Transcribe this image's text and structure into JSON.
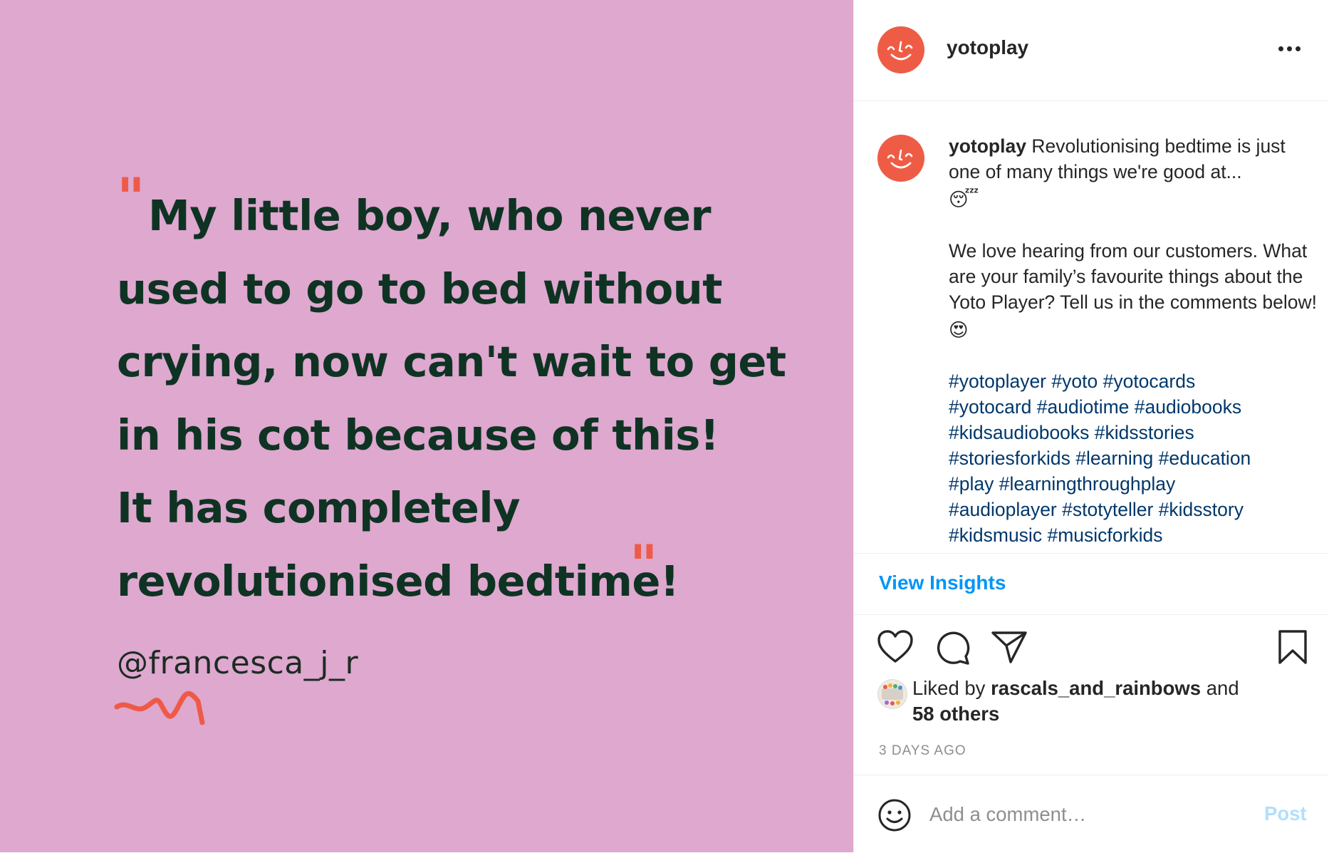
{
  "image": {
    "quote_lines": [
      "My little boy, who never",
      "used to go to bed without",
      "crying, now can't wait to get",
      "in his cot because of this!",
      "It has completely",
      "revolutionised bedtime!"
    ],
    "open_mark": "\"",
    "close_mark": "\"",
    "handle": "@francesca_j_r",
    "colors": {
      "background": "#dea8cf",
      "text": "#0f3323",
      "accent": "#ee5a47"
    }
  },
  "header": {
    "username": "yotoplay",
    "avatar_icon": "smiley-face-icon",
    "more_icon": "more-horizontal-icon"
  },
  "caption": {
    "username": "yotoplay",
    "intro": "Revolutionising bedtime is just one of many things we're good at...",
    "intro_emoji": "😴",
    "body": "We love hearing from our customers. What are your family’s favourite things about the Yoto Player? Tell us in the comments below!",
    "body_emoji": "😍",
    "hashtags": [
      [
        "#yotoplayer",
        "#yoto",
        "#yotocards"
      ],
      [
        "#yotocard",
        "#audiotime",
        "#audiobooks"
      ],
      [
        "#kidsaudiobooks",
        "#kidsstories"
      ],
      [
        "#storiesforkids",
        "#learning",
        "#education"
      ],
      [
        "#play",
        "#learningthroughplay"
      ],
      [
        "#audioplayer",
        "#stotyteller",
        "#kidsstory"
      ],
      [
        "#kidsmusic",
        "#musicforkids"
      ]
    ]
  },
  "insights": {
    "label": "View Insights"
  },
  "actions": {
    "icons": [
      "heart-icon",
      "comment-icon",
      "share-icon",
      "bookmark-icon"
    ],
    "liked_prefix": "Liked by",
    "liked_user": "rascals_and_rainbows",
    "liked_joiner": "and",
    "liked_others": "58 others",
    "timestamp": "3 DAYS AGO"
  },
  "comment": {
    "placeholder": "Add a comment…",
    "post_label": "Post",
    "emoji_icon": "emoji-smiley-icon"
  },
  "colors": {
    "brand": "#ef5c45",
    "link": "#0095f6",
    "hashtag": "#00376b",
    "muted": "#8e8e8e",
    "post_disabled": "#b2dffc"
  }
}
